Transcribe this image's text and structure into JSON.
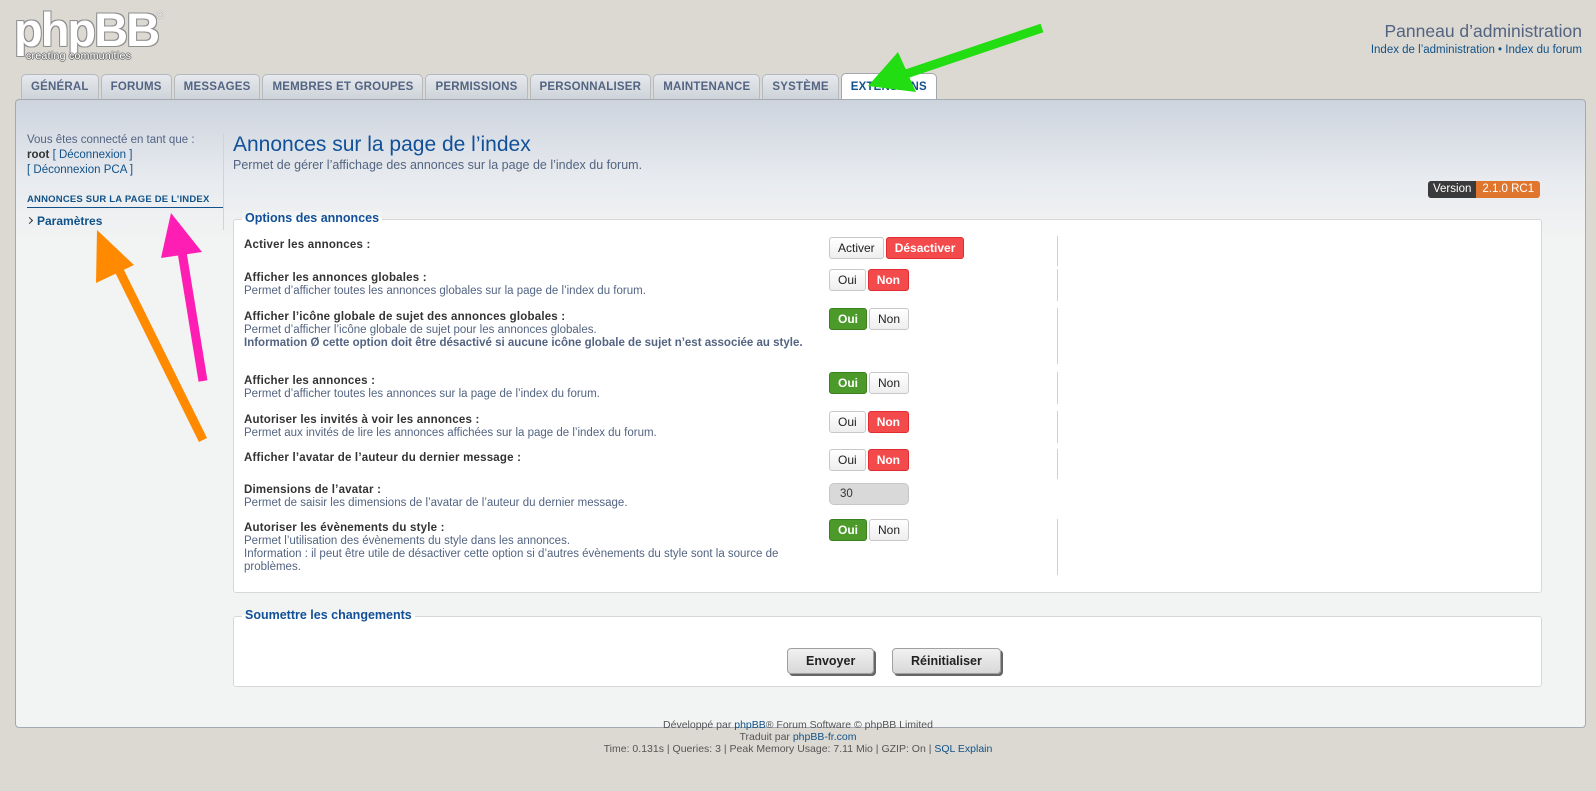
{
  "logo": {
    "text": "phpBB",
    "tagline": "creating  communities",
    "reg": "®"
  },
  "header": {
    "title": "Panneau d’administration",
    "link_admin": "Index de l’administration",
    "separator": "•",
    "link_forum": "Index du forum"
  },
  "tabs": [
    "GÉNÉRAL",
    "FORUMS",
    "MESSAGES",
    "MEMBRES ET GROUPES",
    "PERMISSIONS",
    "PERSONNALISER",
    "MAINTENANCE",
    "SYSTÈME",
    "EXTENSIONS"
  ],
  "active_tab": "EXTENSIONS",
  "sidebar": {
    "connected_as": "Vous êtes connecté en tant que :",
    "user": "root",
    "logout": "[ Déconnexion ]",
    "logout_acp": "[ Déconnexion PCA ]",
    "section": "ANNONCES SUR LA PAGE DE L’INDEX",
    "item": "Paramètres"
  },
  "main": {
    "title": "Annonces sur la page de l’index",
    "subtitle": "Permet de gérer l’affichage des annonces sur la page de l’index du forum.",
    "version_label": "Version",
    "version_value": "2.1.0 RC1"
  },
  "options": {
    "legend": "Options des annonces",
    "rows": [
      {
        "title": "Activer les annonces :",
        "yes": "Activer",
        "no": "Désactiver",
        "selected": "no"
      },
      {
        "title": "Afficher les annonces globales :",
        "desc": "Permet d’afficher toutes les annonces globales sur la page de l’index du forum.",
        "yes": "Oui",
        "no": "Non",
        "selected": "no"
      },
      {
        "title": "Afficher l’icône globale de sujet des annonces globales :",
        "desc": "Permet d’afficher l’icône globale de sujet pour les annonces globales.",
        "desc_bold": "Information Ø cette option doit être désactivé si aucune icône globale de sujet n’est associée au style.",
        "yes": "Oui",
        "no": "Non",
        "selected": "yes"
      },
      {
        "title": "Afficher les annonces :",
        "desc": "Permet d’afficher toutes les annonces sur la page de l’index du forum.",
        "yes": "Oui",
        "no": "Non",
        "selected": "yes"
      },
      {
        "title": "Autoriser les invités à voir les annonces :",
        "desc": "Permet aux invités de lire les annonces affichées sur la page de l’index du forum.",
        "yes": "Oui",
        "no": "Non",
        "selected": "no"
      },
      {
        "title": "Afficher l’avatar de l’auteur du dernier message :",
        "yes": "Oui",
        "no": "Non",
        "selected": "no"
      },
      {
        "title": "Dimensions de l’avatar :",
        "desc": "Permet de saisir les dimensions de l’avatar de l’auteur du dernier message.",
        "value": "30"
      },
      {
        "title": "Autoriser les évènements du style :",
        "desc": "Permet l’utilisation des évènements du style dans les annonces.",
        "desc2": "Information : il peut être utile de désactiver cette option si d’autres évènements du style sont la source de problèmes.",
        "yes": "Oui",
        "no": "Non",
        "selected": "yes"
      }
    ]
  },
  "submit": {
    "legend": "Soumettre les changements",
    "send": "Envoyer",
    "reset": "Réinitialiser"
  },
  "footer": {
    "line1_a": "Développé par ",
    "line1_link": "phpBB",
    "line1_b": "® Forum Software © phpBB Limited",
    "line2_a": "Traduit par ",
    "line2_link": "phpBB-fr.com",
    "line3": "Time: 0.131s | Queries: 3 | Peak Memory Usage: 7.11 Mio | GZIP: On | ",
    "line3_link": "SQL Explain"
  },
  "annotation_colors": {
    "green": "#22dd11",
    "magenta": "#ff1eb4",
    "orange": "#ff8a00"
  }
}
